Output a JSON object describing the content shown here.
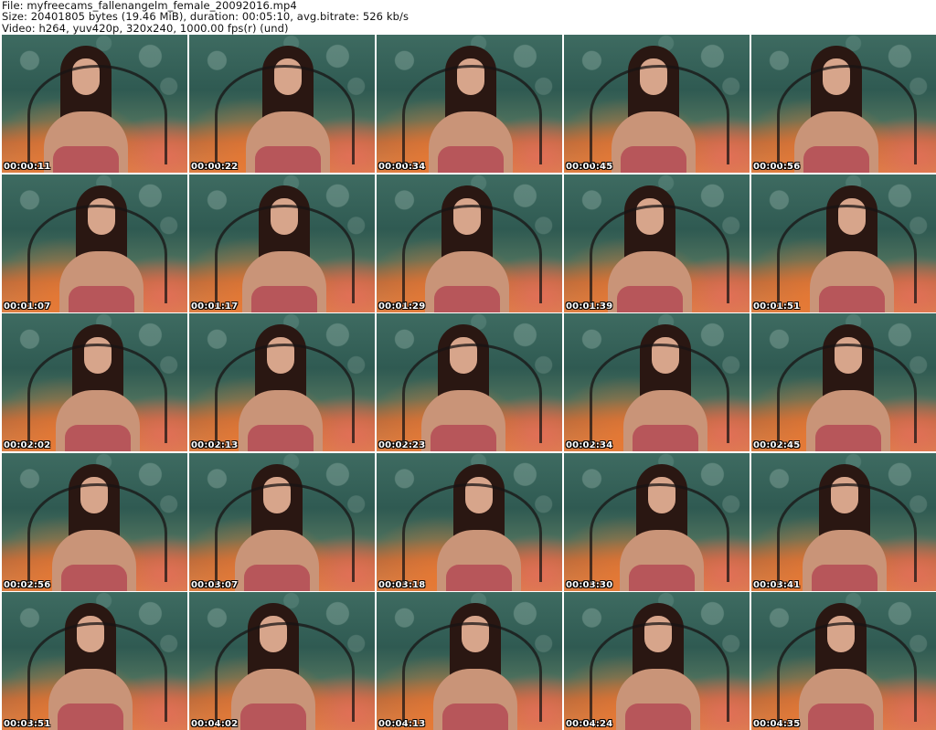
{
  "header": {
    "file_line": "File: myfreecams_fallenangelm_female_20092016.mp4",
    "size_line": "Size: 20401805 bytes (19.46 MiB), duration: 00:05:10, avg.bitrate: 526 kb/s",
    "video_line": "Video: h264, yuv420p, 320x240, 1000.00 fps(r) (und)"
  },
  "thumbnails": [
    {
      "timestamp": "00:00:11"
    },
    {
      "timestamp": "00:00:22"
    },
    {
      "timestamp": "00:00:34"
    },
    {
      "timestamp": "00:00:45"
    },
    {
      "timestamp": "00:00:56"
    },
    {
      "timestamp": "00:01:07"
    },
    {
      "timestamp": "00:01:17"
    },
    {
      "timestamp": "00:01:29"
    },
    {
      "timestamp": "00:01:39"
    },
    {
      "timestamp": "00:01:51"
    },
    {
      "timestamp": "00:02:02"
    },
    {
      "timestamp": "00:02:13"
    },
    {
      "timestamp": "00:02:23"
    },
    {
      "timestamp": "00:02:34"
    },
    {
      "timestamp": "00:02:45"
    },
    {
      "timestamp": "00:02:56"
    },
    {
      "timestamp": "00:03:07"
    },
    {
      "timestamp": "00:03:18"
    },
    {
      "timestamp": "00:03:30"
    },
    {
      "timestamp": "00:03:41"
    },
    {
      "timestamp": "00:03:51"
    },
    {
      "timestamp": "00:04:02"
    },
    {
      "timestamp": "00:04:13"
    },
    {
      "timestamp": "00:04:24"
    },
    {
      "timestamp": "00:04:35"
    }
  ]
}
